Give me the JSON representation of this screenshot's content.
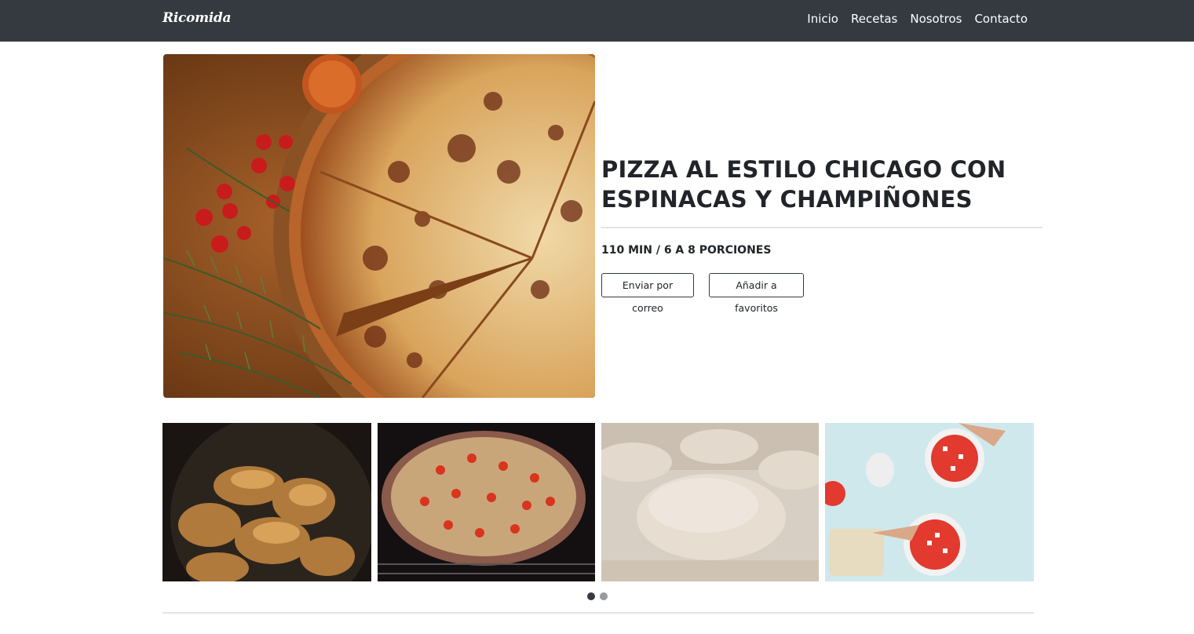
{
  "brand": "Ricomida",
  "nav": {
    "items": [
      "Inicio",
      "Recetas",
      "Nosotros",
      "Contacto"
    ]
  },
  "recipe": {
    "title": "PIZZA AL ESTILO CHICAGO CON ESPINACAS Y CHAMPIÑONES",
    "meta": "110 MIN / 6 A 8 PORCIONES",
    "email_button": "Enviar por correo",
    "favorite_button": "Añadir a favoritos"
  },
  "carousel": {
    "active_index": 0,
    "total_slides": 2
  }
}
